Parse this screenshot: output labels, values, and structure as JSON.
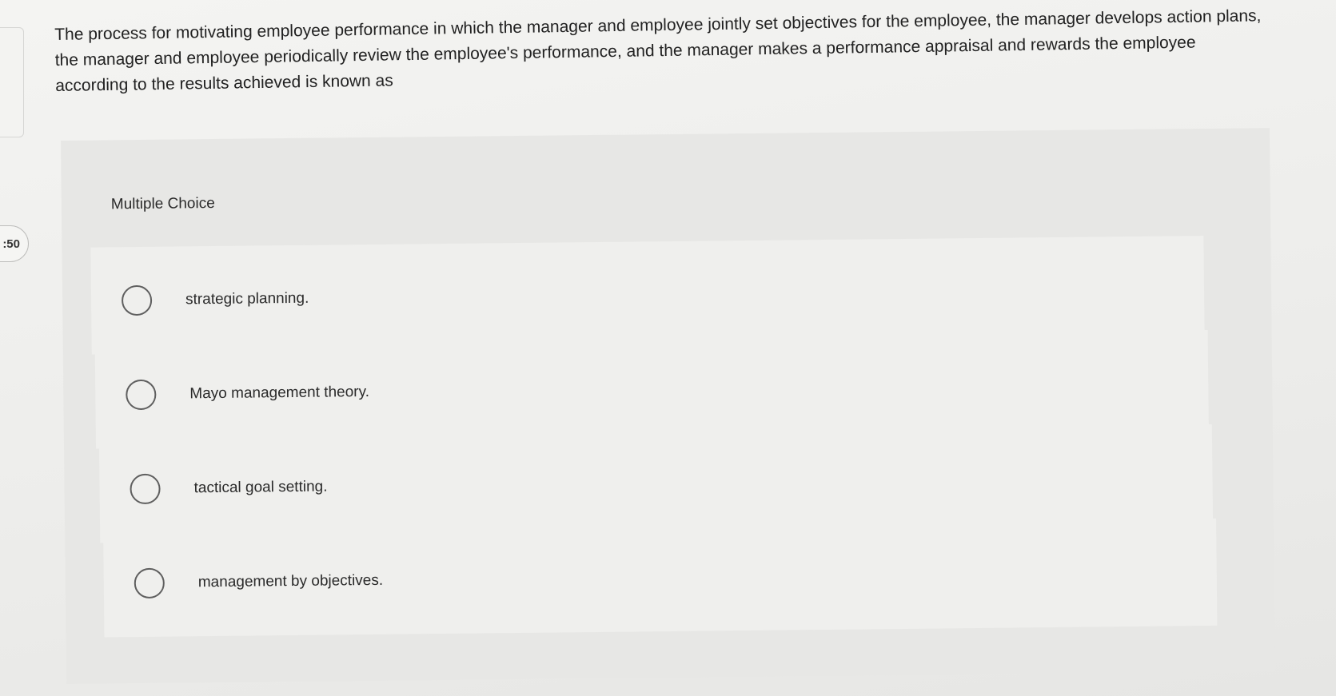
{
  "timer": {
    "text": ":50"
  },
  "question": {
    "text": "The process for motivating employee performance in which the manager and employee jointly set objectives for the employee, the manager develops action plans, the manager and employee periodically review the employee's performance, and the manager makes a performance appraisal and rewards the employee according to the results achieved is known as"
  },
  "question_type": {
    "label": "Multiple Choice"
  },
  "options": [
    {
      "label": "strategic planning."
    },
    {
      "label": "Mayo management theory."
    },
    {
      "label": "tactical goal setting."
    },
    {
      "label": "management by objectives."
    }
  ]
}
